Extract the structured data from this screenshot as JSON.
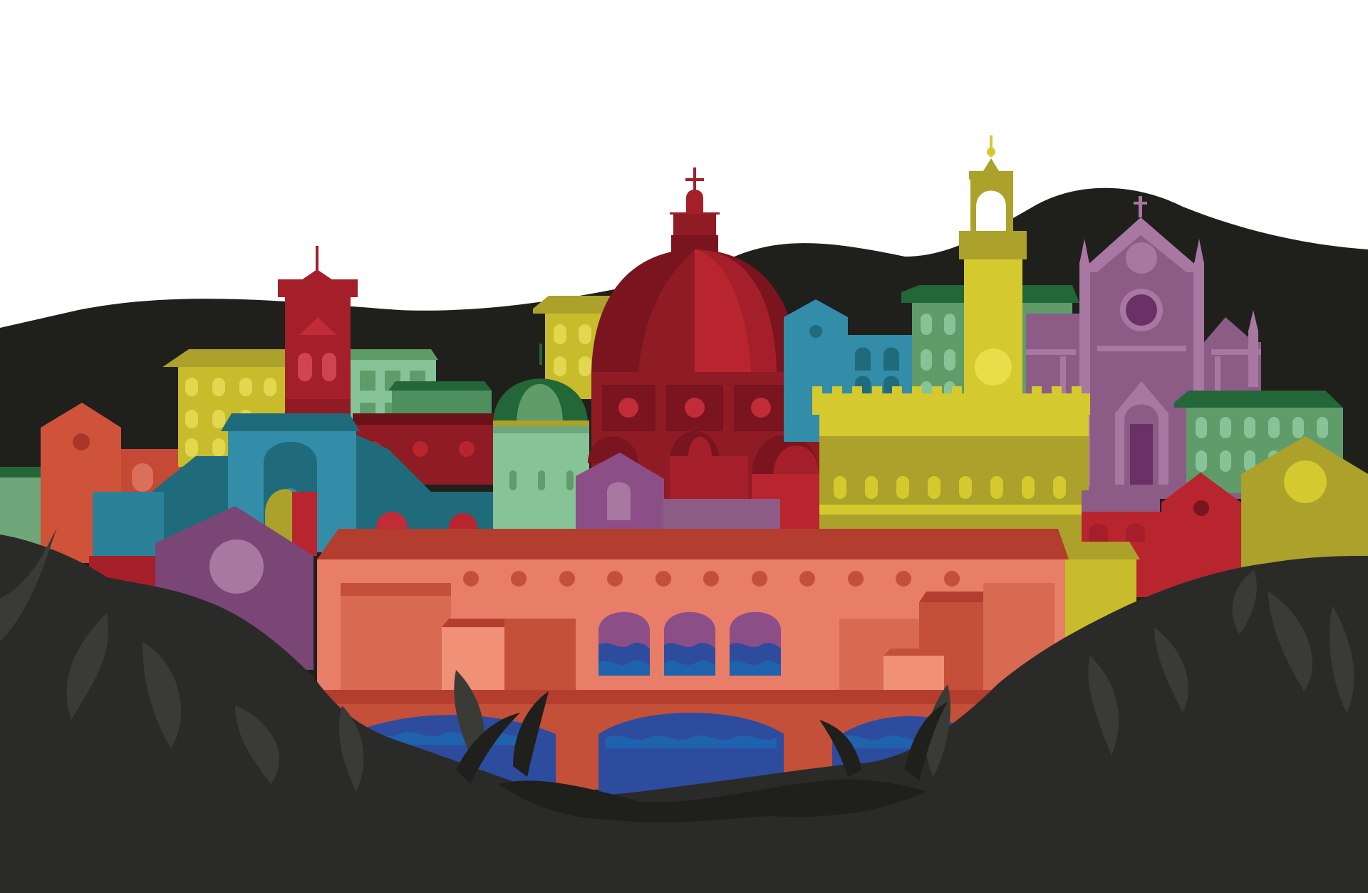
{
  "scene": {
    "subject": "florence-skyline-illustration",
    "palette": {
      "sky": "#ffffff",
      "hills": "#1f1f1c",
      "foreground": "#2a2a28",
      "river": "#2d4c9e",
      "river_light": "#1f62ad",
      "bridge": "#e87d68",
      "bridge_dark": "#c4503a",
      "bridge_roof": "#b33d2e",
      "dome_light": "#b8252f",
      "dome_dark": "#7a141f",
      "cathedral_body": "#8f1b24",
      "palazzo_yellow": "#d4c92e",
      "palazzo_olive": "#aca12a",
      "church_purple": "#8c5c86",
      "church_purple_light": "#a878a2",
      "teal": "#338ca8",
      "teal_dark": "#1f6b7b",
      "green_light": "#86c396",
      "green_mid": "#5f9c69",
      "green_dark": "#236637",
      "orange": "#cf5339",
      "red": "#b8252f",
      "purple": "#7a4676",
      "mustard": "#aba12b"
    },
    "landmarks": [
      {
        "name": "cathedral-dome",
        "icon": "dome-icon"
      },
      {
        "name": "palazzo-vecchio",
        "icon": "tower-icon"
      },
      {
        "name": "santa-croce",
        "icon": "church-icon"
      },
      {
        "name": "ponte-vecchio",
        "icon": "bridge-icon"
      },
      {
        "name": "bargello-tower",
        "icon": "tower-icon"
      }
    ]
  }
}
